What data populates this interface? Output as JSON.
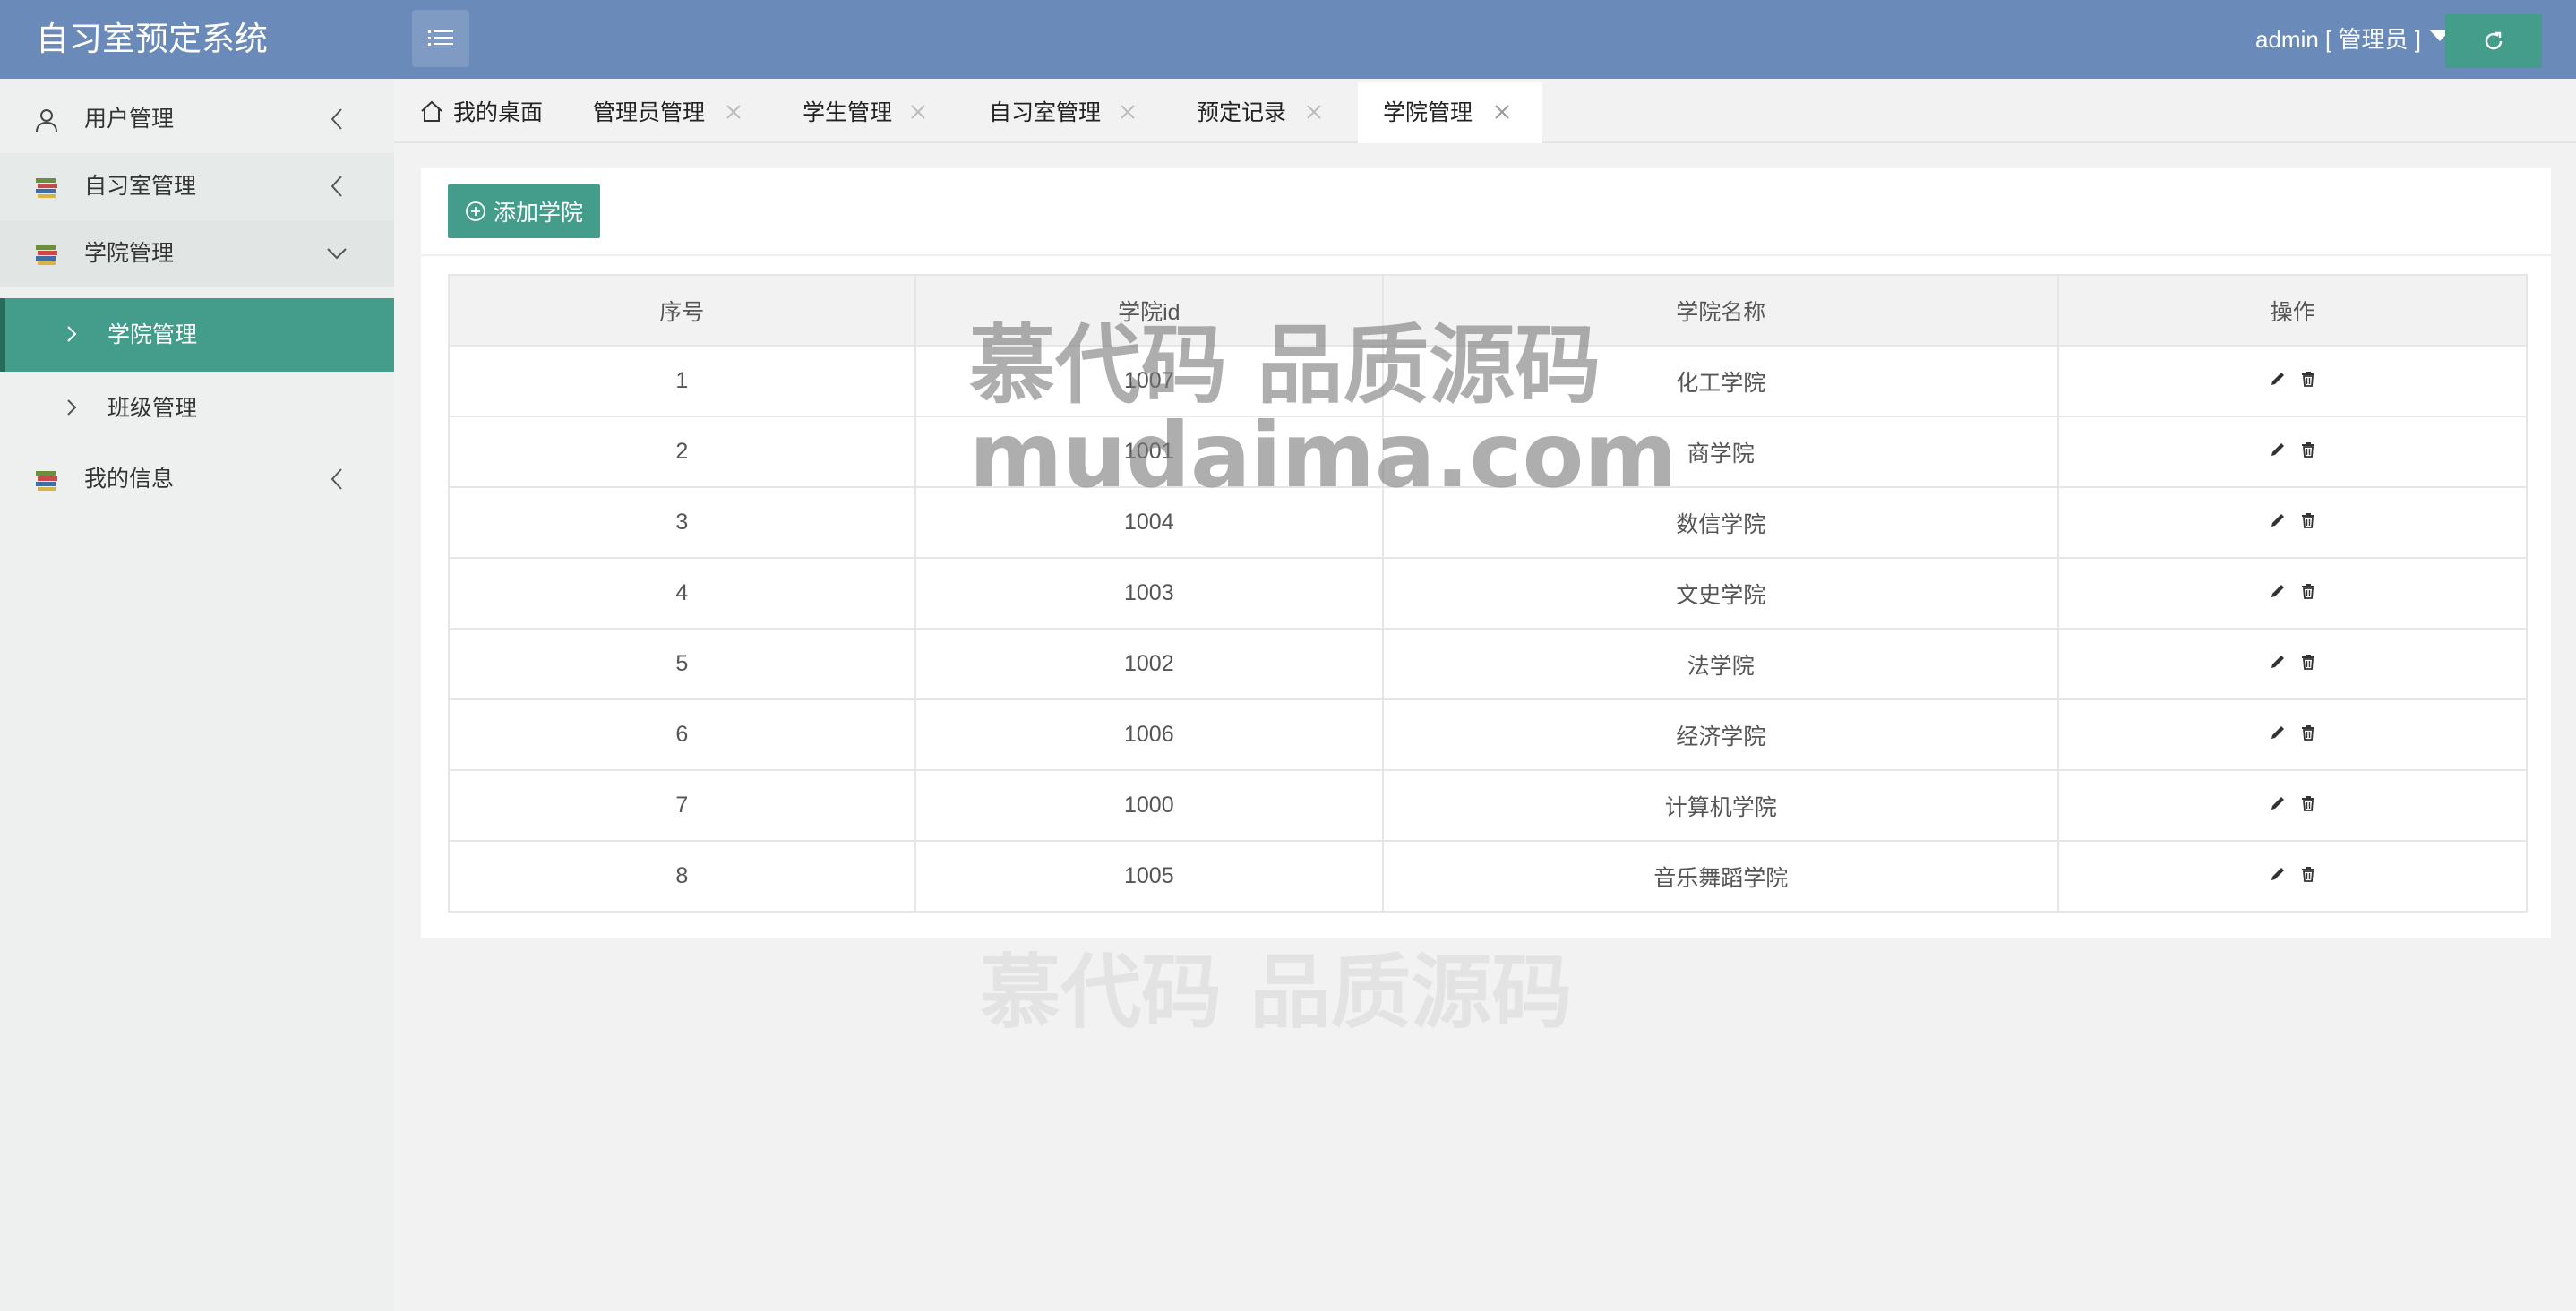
{
  "header": {
    "app_title": "自习室预定系统",
    "user_label": "admin [ 管理员 ]"
  },
  "sidebar": {
    "items": [
      {
        "label": "用户管理",
        "icon": "user-icon"
      },
      {
        "label": "自习室管理",
        "icon": "books-icon"
      },
      {
        "label": "学院管理",
        "icon": "books-icon"
      },
      {
        "label": "我的信息",
        "icon": "books-icon"
      }
    ],
    "sub_items": [
      {
        "label": "学院管理",
        "selected": true
      },
      {
        "label": "班级管理",
        "selected": false
      }
    ]
  },
  "tabs": [
    {
      "label": "我的桌面",
      "icon": "home-icon"
    },
    {
      "label": "管理员管理"
    },
    {
      "label": "学生管理"
    },
    {
      "label": "自习室管理"
    },
    {
      "label": "预定记录"
    },
    {
      "label": "学院管理",
      "active": true
    }
  ],
  "main": {
    "add_button_label": "添加学院",
    "table": {
      "columns": [
        "序号",
        "学院id",
        "学院名称",
        "操作"
      ],
      "rows": [
        {
          "index": "1",
          "id": "1007",
          "name": "化工学院"
        },
        {
          "index": "2",
          "id": "1001",
          "name": "商学院"
        },
        {
          "index": "3",
          "id": "1004",
          "name": "数信学院"
        },
        {
          "index": "4",
          "id": "1003",
          "name": "文史学院"
        },
        {
          "index": "5",
          "id": "1002",
          "name": "法学院"
        },
        {
          "index": "6",
          "id": "1006",
          "name": "经济学院"
        },
        {
          "index": "7",
          "id": "1000",
          "name": "计算机学院"
        },
        {
          "index": "8",
          "id": "1005",
          "name": "音乐舞蹈学院"
        }
      ]
    }
  },
  "watermark": {
    "line1": "慕代码 品质源码",
    "line2": "mudaima.com",
    "line3": "慕代码 品质源码"
  },
  "colors": {
    "header": "#6a8ab9",
    "accent": "#449d8a",
    "sidebar_bg": "#eef0ef"
  }
}
